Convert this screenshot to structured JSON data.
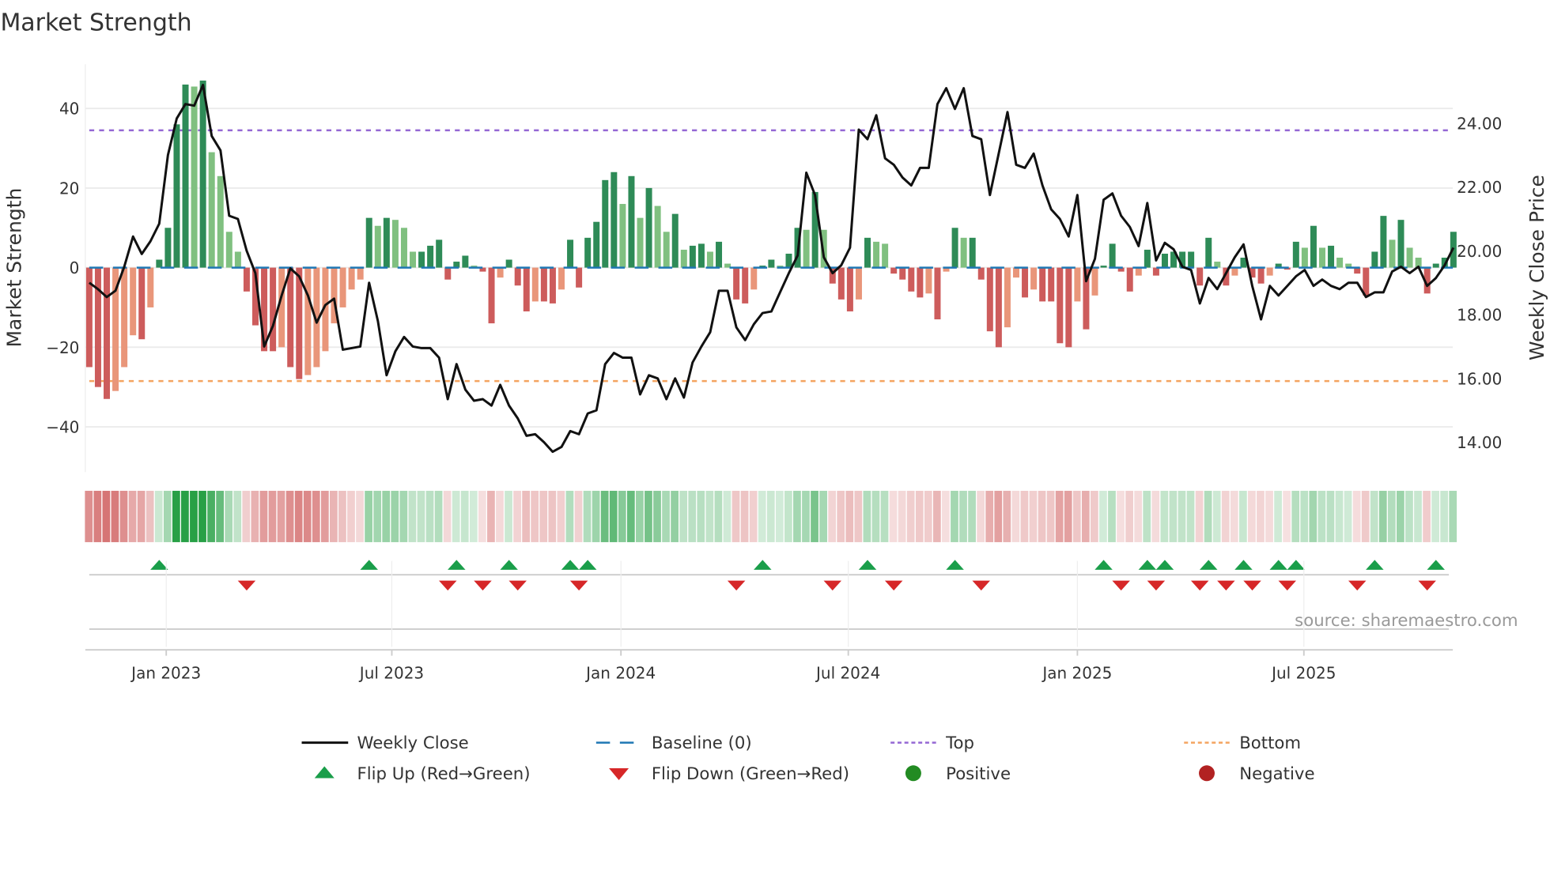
{
  "chart_data": {
    "type": "bar",
    "title": "Market Strength",
    "ylabel": "Market Strength",
    "y2label": "Weekly Close Price",
    "ylim": [
      -51,
      55
    ],
    "y2lim": [
      12.8,
      26.3
    ],
    "yticks": [
      40,
      20,
      0,
      -20,
      -40
    ],
    "yticklabels": [
      "40",
      "20",
      "0",
      "−20",
      "−40"
    ],
    "y2ticks": [
      24,
      22,
      20,
      18,
      16,
      14
    ],
    "y2ticklabels": [
      "24.00",
      "22.00",
      "20.00",
      "18.00",
      "16.00",
      "14.00"
    ],
    "xticklabels": [
      "Jan 2023",
      "Jul 2023",
      "Jan 2024",
      "Jul 2024",
      "Jan 2025",
      "Jul 2025"
    ],
    "xtick_week_index": [
      8.8,
      34.6,
      60.8,
      86.8,
      113.0,
      138.9
    ],
    "top_level": 34.5,
    "bottom_level": -28.5,
    "baseline": 0,
    "strength": [
      -25,
      -30,
      -33,
      -31,
      -25,
      -17,
      -18,
      -10,
      2,
      10,
      36,
      46,
      45.5,
      47,
      29,
      23,
      9,
      4,
      -6,
      -14.5,
      -21,
      -21,
      -20,
      -25,
      -28,
      -27,
      -25,
      -21,
      -14,
      -10,
      -5.5,
      -3,
      12.5,
      10.5,
      12.5,
      12,
      10,
      4,
      4,
      5.5,
      7,
      -3,
      1.5,
      3,
      0.5,
      -1,
      -14,
      -2.5,
      2,
      -4.5,
      -11,
      -8.5,
      -8.5,
      -9,
      -5.5,
      7,
      -5,
      7.5,
      11.5,
      22,
      24,
      16,
      23,
      12.5,
      20,
      15.5,
      9,
      13.5,
      4.5,
      5.5,
      6,
      4,
      6.5,
      1,
      -8,
      -9,
      -5.5,
      0.5,
      2,
      0.5,
      3.5,
      10,
      9.5,
      19,
      9.5,
      -4,
      -8,
      -11,
      -8,
      7.5,
      6.5,
      6,
      -1.5,
      -3,
      -6,
      -7.5,
      -6.5,
      -13,
      -1,
      10,
      7.5,
      7.5,
      -3,
      -16,
      -20,
      -15,
      -2.5,
      -7.5,
      -5.5,
      -8.5,
      -8.5,
      -19,
      -20,
      -8.5,
      -15.5,
      -7,
      0.5,
      6,
      -1,
      -6,
      -2,
      4.5,
      -2,
      3.5,
      4,
      4,
      4,
      -4.5,
      7.5,
      1.5,
      -4.5,
      -2,
      2.5,
      -2.5,
      -4,
      -2,
      1,
      -0.5,
      6.5,
      5,
      10.5,
      5,
      5.5,
      2.5,
      1,
      -1.5,
      -7,
      4,
      13,
      7,
      12,
      5,
      2.5,
      -6.5,
      1,
      2.5,
      9
    ],
    "close": [
      19.0,
      18.8,
      18.55,
      18.75,
      19.5,
      20.45,
      19.9,
      20.3,
      20.85,
      23.0,
      24.15,
      24.6,
      24.55,
      25.2,
      23.6,
      23.15,
      21.1,
      21.0,
      20.0,
      19.3,
      17.0,
      17.65,
      18.6,
      19.45,
      19.2,
      18.6,
      17.75,
      18.3,
      18.5,
      16.9,
      16.95,
      17.0,
      19.0,
      17.8,
      16.1,
      16.85,
      17.3,
      17.0,
      16.95,
      16.95,
      16.65,
      15.35,
      16.45,
      15.65,
      15.3,
      15.35,
      15.15,
      15.8,
      15.15,
      14.75,
      14.2,
      14.25,
      14.0,
      13.7,
      13.85,
      14.35,
      14.25,
      14.9,
      15.0,
      16.45,
      16.8,
      16.65,
      16.65,
      15.5,
      16.1,
      16.0,
      15.35,
      16.0,
      15.4,
      16.5,
      17.0,
      17.45,
      18.75,
      18.75,
      17.6,
      17.2,
      17.7,
      18.05,
      18.1,
      18.7,
      19.3,
      19.85,
      22.45,
      21.75,
      19.8,
      19.3,
      19.55,
      20.1,
      23.8,
      23.5,
      24.25,
      22.9,
      22.7,
      22.3,
      22.05,
      22.6,
      22.6,
      24.6,
      25.1,
      24.45,
      25.1,
      23.6,
      23.5,
      21.75,
      23.05,
      24.35,
      22.7,
      22.6,
      23.05,
      22.05,
      21.3,
      21.0,
      20.45,
      21.75,
      19.05,
      19.75,
      21.6,
      21.8,
      21.1,
      20.75,
      20.15,
      21.5,
      19.7,
      20.25,
      20.05,
      19.5,
      19.4,
      18.35,
      19.15,
      18.8,
      19.3,
      19.8,
      20.2,
      18.9,
      17.85,
      18.9,
      18.6,
      18.9,
      19.2,
      19.4,
      18.9,
      19.1,
      18.9,
      18.8,
      19.0,
      19.0,
      18.55,
      18.7,
      18.7,
      19.35,
      19.5,
      19.3,
      19.5,
      18.9,
      19.15,
      19.55,
      20.1
    ],
    "colors": {
      "pos_rising": "#2e8b57",
      "pos_falling": "#80c080",
      "neg_falling": "#cd5c5c",
      "neg_rising": "#e9967a",
      "close": "#111111",
      "baseline": "#1f77b4",
      "top": "#9467d4",
      "bottom": "#f4a460",
      "flip_up": "#1a9e4a",
      "flip_down": "#d62728",
      "positive": "#228b22",
      "negative": "#b22222"
    },
    "legend": {
      "placement": "bottom-center",
      "items": [
        {
          "label": "Weekly Close",
          "kind": "line"
        },
        {
          "label": "Baseline (0)",
          "kind": "dash"
        },
        {
          "label": "Top",
          "kind": "dot-top"
        },
        {
          "label": "Bottom",
          "kind": "dot-bottom"
        },
        {
          "label": "Flip Up (Red→Green)",
          "kind": "tri-up"
        },
        {
          "label": "Flip Down (Green→Red)",
          "kind": "tri-down"
        },
        {
          "label": "Positive",
          "kind": "circle-pos"
        },
        {
          "label": "Negative",
          "kind": "circle-neg"
        }
      ]
    },
    "source": "source: sharemaestro.com"
  }
}
